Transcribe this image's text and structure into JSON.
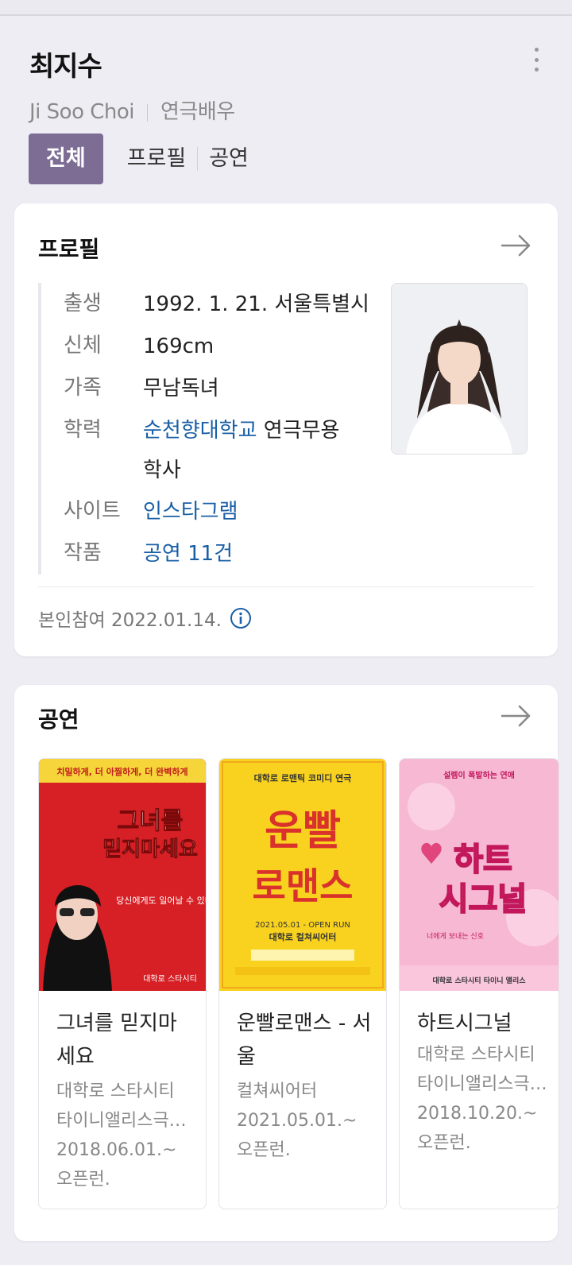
{
  "header": {
    "name": "최지수",
    "english_name": "Ji Soo Choi",
    "occupation": "연극배우"
  },
  "tabs": [
    {
      "label": "전체",
      "active": true
    },
    {
      "label": "프로필",
      "active": false
    },
    {
      "label": "공연",
      "active": false
    }
  ],
  "profile": {
    "title": "프로필",
    "rows": [
      {
        "key": "출생",
        "value": "1992. 1. 21. 서울특별시"
      },
      {
        "key": "신체",
        "value": "169cm"
      },
      {
        "key": "가족",
        "value": "무남독녀"
      },
      {
        "key": "학력",
        "link": "순천향대학교",
        "value": " 연극무용학사"
      },
      {
        "key": "사이트",
        "link": "인스타그램"
      },
      {
        "key": "작품",
        "link": "공연 11건"
      }
    ],
    "footer": "본인참여 2022.01.14."
  },
  "shows": {
    "title": "공연",
    "items": [
      {
        "name": "그녀를 믿지마세요",
        "venue": "대학로 스타시티 타이니앨리스극…",
        "date": "2018.06.01.~",
        "run": "오픈런.",
        "poster": {
          "top_text": "치밀하게, 더 아찔하게, 더 완벽하게",
          "main_text": [
            "그녀를",
            "믿지마세요"
          ],
          "sub_text": "당신에게도 일어날 수 있다",
          "bottom_text": "대학로 스타시티"
        }
      },
      {
        "name": "운빨로맨스 - 서울",
        "venue": "컬쳐씨어터",
        "date": "2021.05.01.~",
        "run": "오픈런.",
        "poster": {
          "top_text": "대학로 로맨틱 코미디 연극",
          "main_text": [
            "운빨",
            "로맨스"
          ],
          "sub_text": "2021.05.01 - OPEN RUN",
          "bottom_text": "대학로 컬쳐씨어터"
        }
      },
      {
        "name": "하트시그널",
        "venue": "대학로 스타시티 타이니앨리스극…",
        "date": "2018.10.20.~",
        "run": "오픈런.",
        "poster": {
          "top_text": "설렘이 폭발하는 연애",
          "main_text": [
            "하트",
            "시그널"
          ],
          "sub_text": "너에게 보내는 신호",
          "bottom_text": "대학로 스타시티 타이니 앨리스"
        }
      }
    ]
  },
  "colors": {
    "accent": "#7d6d94",
    "link": "#1a5fa6",
    "background": "#efedf4"
  }
}
